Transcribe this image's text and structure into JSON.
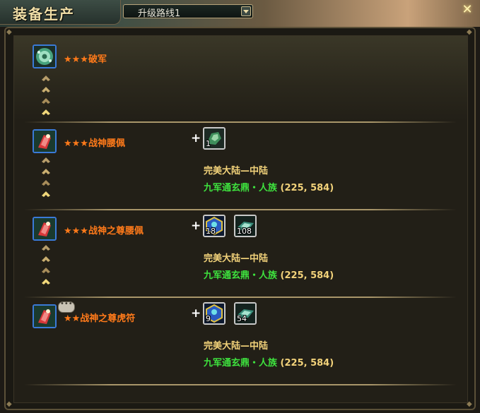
{
  "header": {
    "title": "装备生产",
    "route_select": {
      "value": "升级路线1"
    },
    "close_icon": "close-icon"
  },
  "colors": {
    "item_name": "#ff7a1a",
    "region": "#f2d27a",
    "place": "#3ee23e",
    "icon_border": "#3a7ad8"
  },
  "items": [
    {
      "name": "★★★破军",
      "icon": "jade-disc-icon",
      "has_requirements": false
    },
    {
      "name": "★★★战神腰佩",
      "icon": "red-crystal-pendant-icon",
      "materials": [
        {
          "icon": "green-ore-icon",
          "qty": "1"
        }
      ],
      "region": "完美大陆—中陆",
      "location": "九军通玄鼎・人族",
      "coords": "(225, 584)"
    },
    {
      "name": "★★★战神之尊腰佩",
      "icon": "red-crystal-pendant-icon",
      "materials": [
        {
          "icon": "blue-seal-icon",
          "qty": "18"
        },
        {
          "icon": "teal-ingot-icon",
          "qty": "108"
        }
      ],
      "region": "完美大陆—中陆",
      "location": "九军通玄鼎・人族",
      "coords": "(225, 584)"
    },
    {
      "name": "★★战神之尊虎符",
      "icon": "red-crystal-pendant-icon",
      "materials": [
        {
          "icon": "blue-seal-icon",
          "qty": "9"
        },
        {
          "icon": "teal-ingot-icon",
          "qty": "54"
        }
      ],
      "region": "完美大陆—中陆",
      "location": "九军通玄鼎・人族",
      "coords": "(225, 584)"
    }
  ]
}
